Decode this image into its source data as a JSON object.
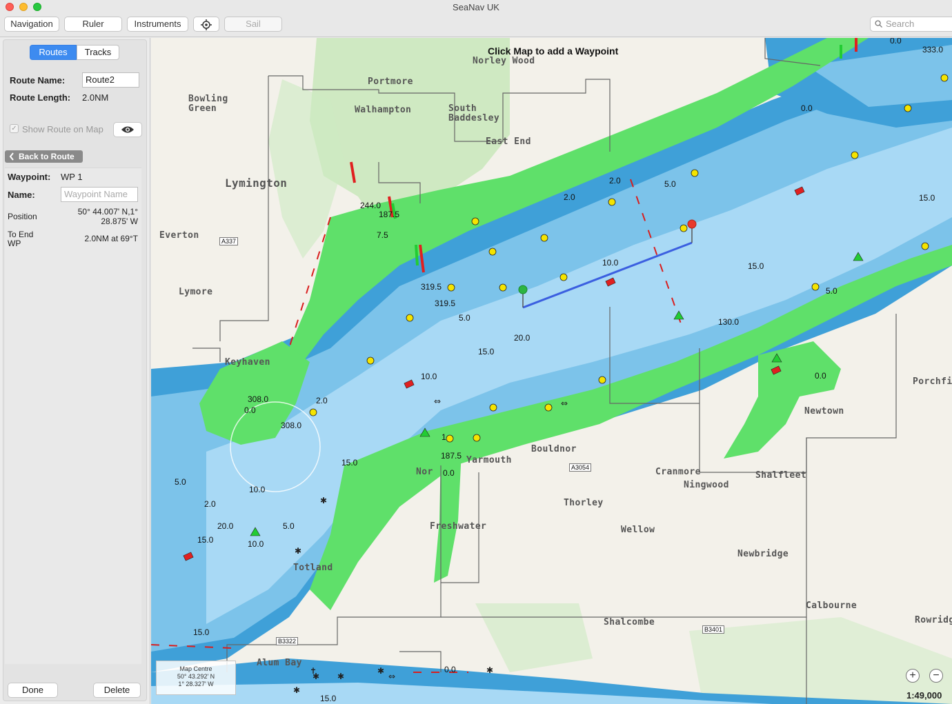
{
  "window": {
    "title": "SeaNav UK"
  },
  "toolbar": {
    "navigation": "Navigation",
    "ruler": "Ruler",
    "instruments": "Instruments",
    "sail": "Sail",
    "search_placeholder": "Search"
  },
  "sidebar": {
    "tabs": [
      "Routes",
      "Tracks"
    ],
    "route_name_label": "Route Name:",
    "route_name_value": "Route2",
    "route_length_label": "Route Length:",
    "route_length_value": "2.0NM",
    "show_route_label": "Show Route on Map",
    "back_to_route": "Back to Route",
    "waypoint_label": "Waypoint:",
    "waypoint_value": "WP 1",
    "name_label": "Name:",
    "name_placeholder": "Waypoint Name",
    "position_label": "Position",
    "position_line1": "50° 44.007' N,1°",
    "position_line2": "28.875' W",
    "to_end_label_1": "To End",
    "to_end_label_2": "WP",
    "to_end_value": "2.0NM at 69°T",
    "done": "Done",
    "delete": "Delete"
  },
  "map": {
    "hint": "Click Map to add a Waypoint",
    "centre_title": "Map Centre",
    "centre_lat": "50° 43.292' N",
    "centre_lon": "1° 28.327' W",
    "scale": "1:49,000",
    "zoom_in": "+",
    "zoom_out": "−",
    "places": [
      "Norley Wood",
      "Portmore",
      "Bowling",
      "Green",
      "Walhampton",
      "South",
      "Baddesley",
      "East End",
      "Lymington",
      "Everton",
      "Lymore",
      "Keyhaven",
      "Yarmouth",
      "Bouldnor",
      "Cranmore",
      "Ningwood",
      "Shalfleet",
      "Newtown",
      "Porchfie",
      "Thorley",
      "Wellow",
      "Newbridge",
      "Freshwater",
      "Totland",
      "Calbourne",
      "Shalcombe",
      "Alum Bay",
      "Rowridg",
      "Nor"
    ],
    "roads": [
      "A337",
      "A3054",
      "B3322",
      "B3401"
    ],
    "depths": [
      "0.0",
      "333.0",
      "0.0",
      "2.0",
      "5.0",
      "2.0",
      "15.0",
      "10.0",
      "15.0",
      "5.0",
      "244.0",
      "187.5",
      "7.5",
      "319.5",
      "319.5",
      "5.0",
      "20.0",
      "15.0",
      "130.0",
      "0.0",
      "10.0",
      "308.0",
      "0.0",
      "2.0",
      "308.0",
      "15.0",
      "5.0",
      "10.0",
      "2.0",
      "20.0",
      "15.0",
      "5.0",
      "10.0",
      "15.0",
      "0.0",
      "15.0",
      "187.5",
      "0.0",
      "1"
    ]
  },
  "colors": {
    "land": "#f3f1ea",
    "green_land": "#9fd88f",
    "intertidal": "#5fe06a",
    "deep_blue": "#3fa0d8",
    "mid_blue": "#7cc3ea",
    "light_blue": "#a8d9f5",
    "route": "#3b5fe0"
  }
}
